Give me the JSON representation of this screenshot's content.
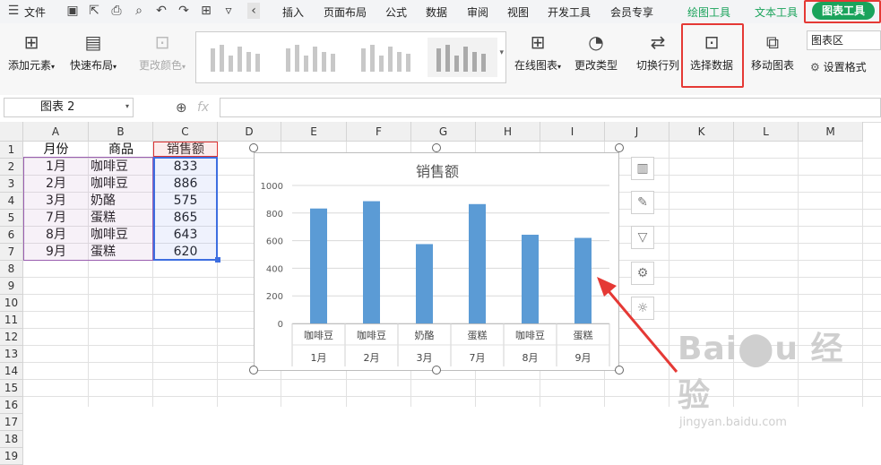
{
  "menu": {
    "file": "文件",
    "tabs": [
      "插入",
      "页面布局",
      "公式",
      "数据",
      "审阅",
      "视图",
      "开发工具",
      "会员专享"
    ],
    "chart_tabs": {
      "draw": "绘图工具",
      "text": "文本工具",
      "chart": "图表工具"
    }
  },
  "ribbon": {
    "add_element": "添加元素",
    "quick_layout": "快速布局",
    "change_color": "更改颜色",
    "online_chart": "在线图表",
    "change_type": "更改类型",
    "switch_row_col": "切换行列",
    "select_data": "选择数据",
    "move_chart": "移动图表",
    "chart_area": "图表区",
    "set_format": "设置格式"
  },
  "formula_bar": {
    "name_box": "图表 2",
    "fx": "fx"
  },
  "columns": [
    "A",
    "B",
    "C",
    "D",
    "E",
    "F",
    "G",
    "H",
    "I",
    "J",
    "K",
    "L",
    "M"
  ],
  "rows": [
    "1",
    "2",
    "3",
    "4",
    "5",
    "6",
    "7",
    "8",
    "9",
    "10",
    "11",
    "12",
    "13",
    "14",
    "15",
    "16",
    "17",
    "18",
    "19"
  ],
  "sheet": {
    "headers": [
      "月份",
      "商品",
      "销售额"
    ],
    "data": [
      [
        "1月",
        "咖啡豆",
        "833"
      ],
      [
        "2月",
        "咖啡豆",
        "886"
      ],
      [
        "3月",
        "奶酪",
        "575"
      ],
      [
        "7月",
        "蛋糕",
        "865"
      ],
      [
        "8月",
        "咖啡豆",
        "643"
      ],
      [
        "9月",
        "蛋糕",
        "620"
      ]
    ]
  },
  "chart_data": {
    "type": "bar",
    "title": "销售额",
    "categories": [
      [
        "咖啡豆",
        "1月"
      ],
      [
        "咖啡豆",
        "2月"
      ],
      [
        "奶酪",
        "3月"
      ],
      [
        "蛋糕",
        "7月"
      ],
      [
        "咖啡豆",
        "8月"
      ],
      [
        "蛋糕",
        "9月"
      ]
    ],
    "values": [
      833,
      886,
      575,
      865,
      643,
      620
    ],
    "ylim": [
      0,
      1000
    ],
    "yticks": [
      "0",
      "200",
      "400",
      "600",
      "800",
      "1000"
    ],
    "bar_color": "#5b9bd5",
    "grid": true
  },
  "watermark": "jingyan.baidu.com",
  "colors": {
    "accent_green": "#1aa35b",
    "highlight_red": "#e53935"
  }
}
